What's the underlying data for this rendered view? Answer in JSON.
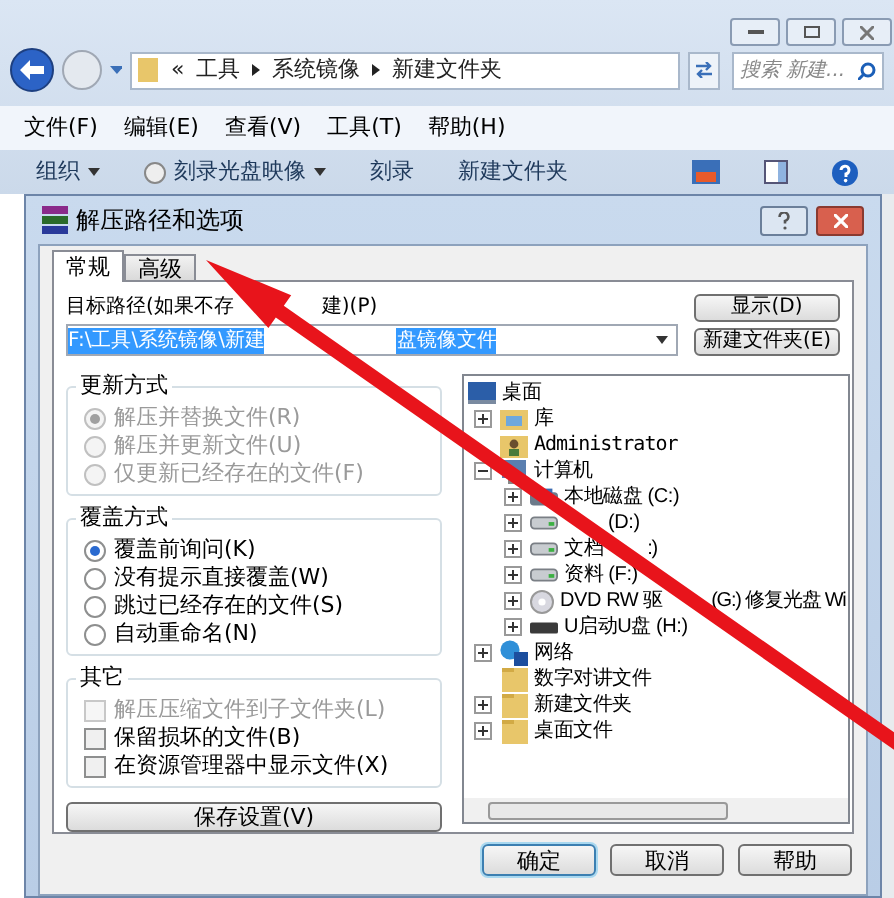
{
  "explorer": {
    "address": [
      "«",
      "工具",
      "系统镜像",
      "新建文件夹"
    ],
    "search": {
      "placeholder": "搜索 新建..."
    },
    "menu": [
      "文件(F)",
      "编辑(E)",
      "查看(V)",
      "工具(T)",
      "帮助(H)"
    ],
    "toolbar": [
      {
        "label": "组织",
        "kind": "dropdown"
      },
      {
        "label": "刻录光盘映像",
        "kind": "disc"
      },
      {
        "label": "刻录",
        "kind": "plain"
      },
      {
        "label": "新建文件夹",
        "kind": "plain"
      }
    ]
  },
  "dialog": {
    "title": "解压路径和选项",
    "tabs": [
      {
        "label": "常规",
        "selected": true
      },
      {
        "label": "高级",
        "selected": false
      }
    ],
    "path_label": [
      "目标路径(如果不存",
      "建)(P)"
    ],
    "path_value": [
      "F:\\工具\\系统镜像\\新建",
      "盘镜像文件"
    ],
    "side_buttons": [
      "显示(D)",
      "新建文件夹(E)"
    ],
    "groups": [
      {
        "title": "更新方式",
        "kind": "radio",
        "options": [
          {
            "label": "解压并替换文件(R)",
            "selected": true,
            "disabled": true
          },
          {
            "label": "解压并更新文件(U)",
            "selected": false,
            "disabled": true
          },
          {
            "label": "仅更新已经存在的文件(F)",
            "selected": false,
            "disabled": true
          }
        ]
      },
      {
        "title": "覆盖方式",
        "kind": "radio",
        "options": [
          {
            "label": "覆盖前询问(K)",
            "selected": true,
            "disabled": false
          },
          {
            "label": "没有提示直接覆盖(W)",
            "selected": false,
            "disabled": false
          },
          {
            "label": "跳过已经存在的文件(S)",
            "selected": false,
            "disabled": false
          },
          {
            "label": "自动重命名(N)",
            "selected": false,
            "disabled": false
          }
        ]
      },
      {
        "title": "其它",
        "kind": "checkbox",
        "options": [
          {
            "label": "解压压缩文件到子文件夹(L)",
            "checked": false,
            "disabled": true
          },
          {
            "label": "保留损坏的文件(B)",
            "checked": false,
            "disabled": false
          },
          {
            "label": "在资源管理器中显示文件(X)",
            "checked": false,
            "disabled": false
          }
        ]
      }
    ],
    "save_button": "保存设置(V)",
    "tree": [
      {
        "parts": [
          "桌面"
        ],
        "kind": "desktop",
        "children": [
          {
            "parts": [
              "库"
            ],
            "kind": "library",
            "expandable": true,
            "expanded": false
          },
          {
            "parts": [
              "Administrator"
            ],
            "kind": "user"
          },
          {
            "parts": [
              "计算机"
            ],
            "kind": "computer",
            "expandable": true,
            "expanded": true,
            "children": [
              {
                "parts": [
                  "本地磁盘 (C:)"
                ],
                "kind": "system-drive",
                "expandable": true,
                "expanded": false
              },
              {
                "parts": [
                  "(D:)"
                ],
                "kind": "drive",
                "expandable": true,
                "expanded": false
              },
              {
                "parts": [
                  "文档",
                  ":)"
                ],
                "kind": "drive",
                "expandable": true,
                "expanded": false
              },
              {
                "parts": [
                  "资料 (F:)"
                ],
                "kind": "drive",
                "expandable": true,
                "expanded": false
              },
              {
                "parts": [
                  "DVD RW 驱",
                  "(G:) 修复光盘 Wi"
                ],
                "kind": "dvd",
                "expandable": true,
                "expanded": false
              },
              {
                "parts": [
                  "U启动U盘 (H:)"
                ],
                "kind": "usb",
                "expandable": true,
                "expanded": false
              }
            ]
          },
          {
            "parts": [
              "网络"
            ],
            "kind": "network",
            "expandable": true,
            "expanded": false
          },
          {
            "parts": [
              "数字对讲文件"
            ],
            "kind": "folder",
            "expandable": false
          },
          {
            "parts": [
              "新建文件夹"
            ],
            "kind": "folder",
            "expandable": true,
            "expanded": false
          },
          {
            "parts": [
              "桌面文件"
            ],
            "kind": "folder",
            "expandable": true,
            "expanded": false
          }
        ]
      }
    ],
    "footer_buttons": [
      {
        "label": "确定",
        "selected": true
      },
      {
        "label": "取消",
        "selected": false
      },
      {
        "label": "帮助",
        "selected": false
      }
    ]
  }
}
